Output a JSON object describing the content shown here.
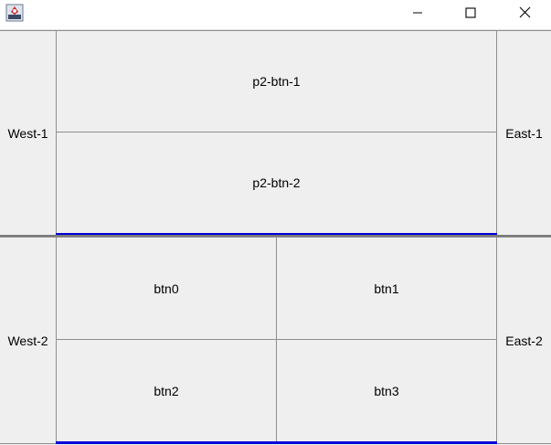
{
  "window": {
    "icons": {
      "app": "java-app-icon",
      "minimize": "minimize-icon",
      "maximize": "maximize-icon",
      "close": "close-icon"
    }
  },
  "panel1": {
    "west": "West-1",
    "east": "East-1",
    "center": [
      "p2-btn-1",
      "p2-btn-2"
    ]
  },
  "panel2": {
    "west": "West-2",
    "east": "East-2",
    "grid": [
      "btn0",
      "btn1",
      "btn2",
      "btn3"
    ]
  },
  "colors": {
    "focus_border": "#0000d8",
    "button_bg": "#efefef",
    "button_border": "#8e8e8e"
  }
}
